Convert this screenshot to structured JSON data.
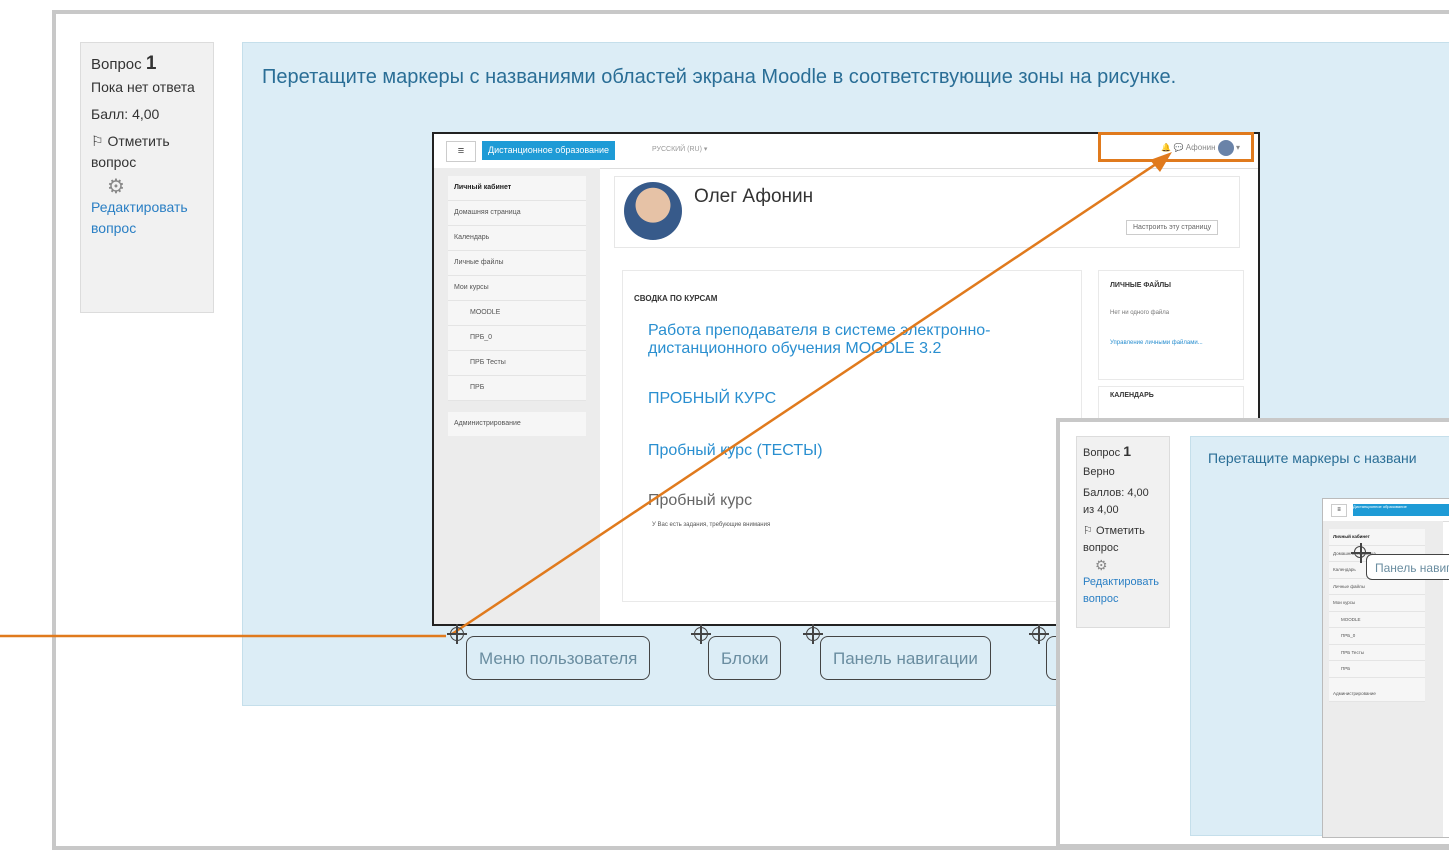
{
  "info": {
    "question_label": "Вопрос",
    "question_number": "1",
    "state": "Пока нет ответа",
    "mark": "Балл: 4,00",
    "flag_label": "Отметить вопрос",
    "edit_label": "Редактировать вопрос"
  },
  "question_text": "Перетащите маркеры с названиями областей экрана Moodle в соответствующие зоны на рисунке.",
  "screenshot": {
    "menu_icon": "≡",
    "site_name": "Дистанционное образование",
    "language": "РУССКИЙ (RU) ▾",
    "user_menu": "Афонин",
    "user_name": "Олег Афонин",
    "customize_button": "Настроить эту страницу",
    "nav_items": [
      "Личный кабинет",
      "Домашняя страница",
      "Календарь",
      "Личные файлы",
      "Мои курсы"
    ],
    "nav_subitems": [
      "MOODLE",
      "ПРБ_0",
      "ПРБ Тесты",
      "ПРБ"
    ],
    "admin_item": "Администрирование",
    "course_overview_title": "СВОДКА ПО КУРСАМ",
    "courses": [
      "Работа преподавателя в системе электронно-дистанционного обучения MOODLE 3.2",
      "ПРОБНЫЙ КУРС",
      "Пробный курс (ТЕСТЫ)",
      "Пробный курс"
    ],
    "course_notice": "У Вас есть задания, требующие внимания",
    "block_files_title": "ЛИЧНЫЕ ФАЙЛЫ",
    "block_files_empty": "Нет ни одного файла",
    "block_files_link": "Управление личными файлами...",
    "block_calendar_title": "КАЛЕНДАРЬ"
  },
  "markers": [
    "Меню пользователя",
    "Блоки",
    "Панель навигации"
  ],
  "overlay": {
    "question_label": "Вопрос",
    "question_number": "1",
    "state": "Верно",
    "mark": "Баллов: 4,00 из 4,00",
    "flag_label": "Отметить вопрос",
    "edit_label": "Редактировать вопрос",
    "question_text": "Перетащите маркеры с названи",
    "marker_text": "Панель навигации",
    "nav_items": [
      "Личный кабинет",
      "Домашняя страница",
      "Календарь",
      "Личные файлы",
      "Мои курсы"
    ],
    "nav_subitems": [
      "MOODLE",
      "ПРБ_0",
      "ПРБ Тесты",
      "ПРБ"
    ],
    "admin_item": "Администрирование",
    "site_name": "Дистанционное образование"
  },
  "colors": {
    "accent": "#e07a1d",
    "panel": "#dcedf6",
    "link": "#2a8fd0"
  }
}
